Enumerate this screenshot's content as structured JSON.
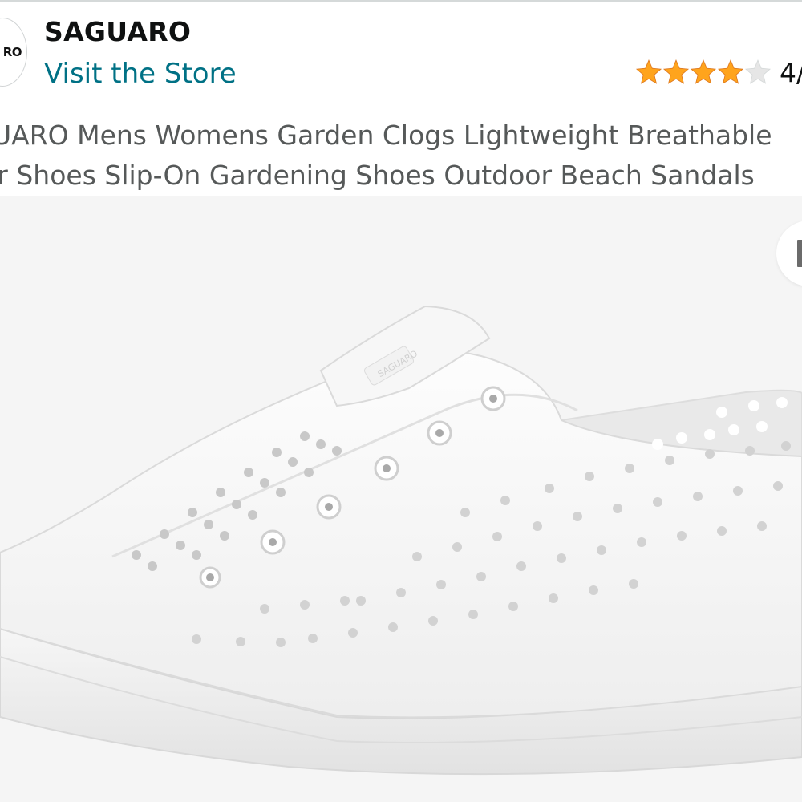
{
  "brand": {
    "logo_text": "RO",
    "name": "SAGUARO",
    "store_link": "Visit the Store"
  },
  "rating": {
    "stars": 4,
    "max_stars": 5,
    "display_text": "4/",
    "star_color": "#ffa41c",
    "empty_star_color": "#d5d9d9"
  },
  "product": {
    "title_line1": "UARO Mens Womens Garden Clogs Lightweight Breathable",
    "title_line2": "er Shoes Slip-On Gardening Shoes Outdoor Beach Sandals",
    "image_label": "SAGUARO"
  },
  "colors": {
    "link": "#007185",
    "title": "#565959",
    "image_bg": "#f5f5f5"
  }
}
